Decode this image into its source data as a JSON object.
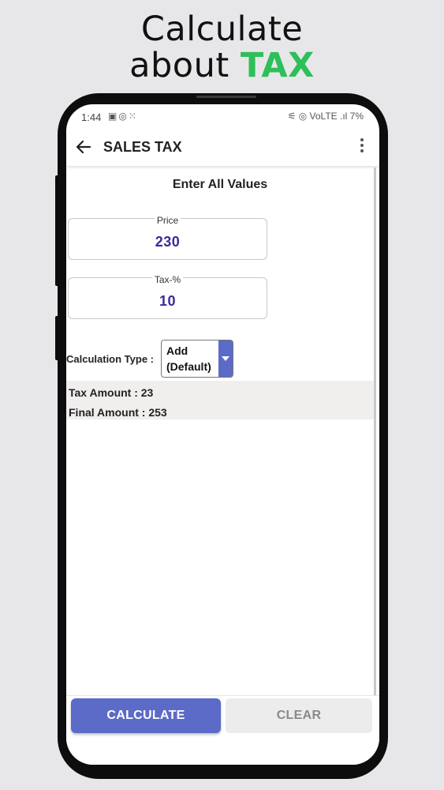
{
  "promo": {
    "line1": "Calculate",
    "line2_prefix": "about ",
    "line2_accent": "TAX",
    "accent_color": "#2fbf5a"
  },
  "status_bar": {
    "time": "1:44",
    "left_icons": [
      "facebook-icon",
      "instagram-icon",
      "apps-icon"
    ],
    "right_text": "⚟ ◎ VoLTE .ıl 7%",
    "battery": "7%"
  },
  "app_bar": {
    "title": "SALES TAX",
    "back_icon": "arrow-left-icon",
    "menu_icon": "more-vertical-icon"
  },
  "form": {
    "heading": "Enter All Values",
    "price": {
      "label": "Price",
      "value": "230"
    },
    "tax": {
      "label": "Tax-%",
      "value": "10"
    },
    "calc_type": {
      "label": "Calculation Type :",
      "selected_line1": "Add",
      "selected_line2": "(Default)"
    }
  },
  "results": {
    "tax_amount": "Tax Amount : 23",
    "final_amount": "Final Amount : 253"
  },
  "buttons": {
    "calculate": "CALCULATE",
    "clear": "CLEAR"
  },
  "colors": {
    "primary": "#5b6bc7",
    "value_text": "#3a2a9a"
  }
}
